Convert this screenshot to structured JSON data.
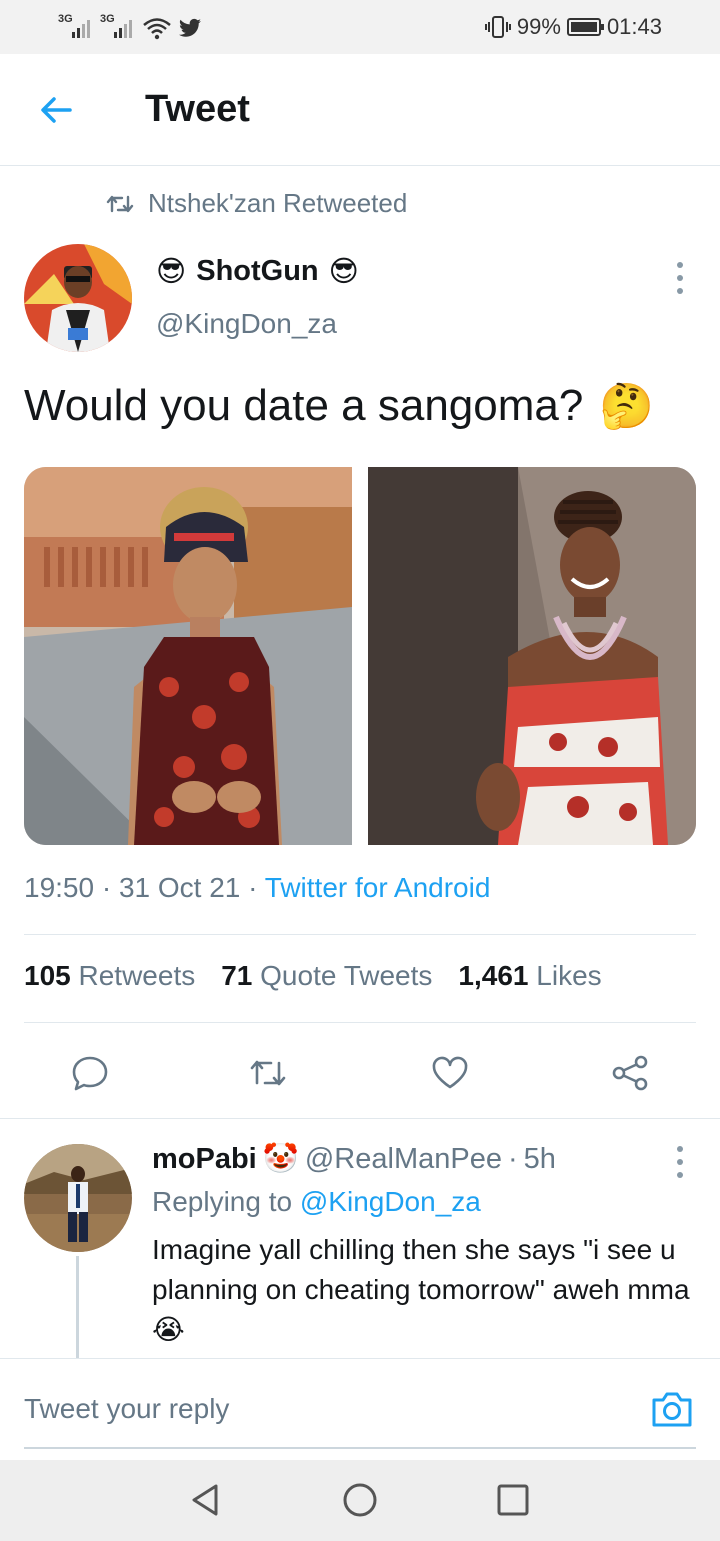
{
  "status_bar": {
    "signal1_label": "3G",
    "signal2_label": "3G",
    "battery_percent": "99%",
    "time": "01:43"
  },
  "header": {
    "title": "Tweet"
  },
  "retweet_context": {
    "text": "Ntshek'zan Retweeted"
  },
  "tweet": {
    "author_emoji_left": "😎",
    "author_name": "ShotGun",
    "author_emoji_right": "😎",
    "author_handle": "@KingDon_za",
    "text": "Would you date a sangoma?",
    "text_emoji": "🤔",
    "time": "19:50",
    "date": "31 Oct 21",
    "source": "Twitter for Android",
    "meta_sep": "·",
    "stats": {
      "retweets_count": "105",
      "retweets_label": "Retweets",
      "quotes_count": "71",
      "quotes_label": "Quote Tweets",
      "likes_count": "1,461",
      "likes_label": "Likes"
    }
  },
  "reply": {
    "author_name": "moPabi",
    "author_emoji": "🤡",
    "author_handle": "@RealManPee",
    "sep": "·",
    "age": "5h",
    "replying_prefix": "Replying to",
    "replying_handle": "@KingDon_za",
    "text": "Imagine yall chilling then she says \"i see u planning on cheating tomorrow\" aweh mma",
    "text_emoji": "😭"
  },
  "composer": {
    "placeholder": "Tweet your reply"
  },
  "icons": {
    "back": "arrow-left-icon",
    "retweet": "retweet-icon",
    "reply": "reply-icon",
    "like": "heart-icon",
    "share": "share-icon",
    "more": "more-vertical-icon",
    "camera": "camera-icon"
  },
  "colors": {
    "accent": "#1da1f2",
    "secondary_text": "#657786",
    "primary_text": "#14171a"
  }
}
